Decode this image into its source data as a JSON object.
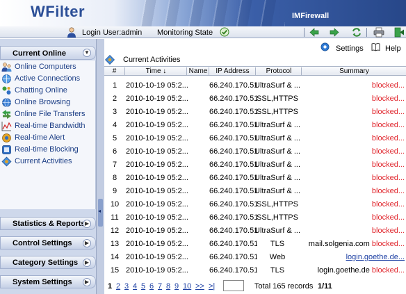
{
  "app": {
    "logo": "WFilter",
    "product": "IMFirewall"
  },
  "topbar": {
    "login_label": "Login User:admin",
    "monitor_label": "Monitoring State"
  },
  "sidebar": {
    "header": "Current Online",
    "items": [
      {
        "label": "Online Computers",
        "icon": "computers-icon"
      },
      {
        "label": "Active Connections",
        "icon": "connections-icon"
      },
      {
        "label": "Chatting Online",
        "icon": "chat-icon"
      },
      {
        "label": "Online Browsing",
        "icon": "globe-icon"
      },
      {
        "label": "Online File Transfers",
        "icon": "file-transfer-icon"
      },
      {
        "label": "Real-time Bandwidth",
        "icon": "bandwidth-icon"
      },
      {
        "label": "Real-time Alert",
        "icon": "alert-icon"
      },
      {
        "label": "Real-time Blocking",
        "icon": "blocking-icon"
      },
      {
        "label": "Current Activities",
        "icon": "activities-icon"
      }
    ],
    "sections": [
      "Statistics & Reports",
      "Control Settings",
      "Category Settings",
      "System Settings"
    ]
  },
  "main": {
    "settings_label": "Settings",
    "help_label": "Help",
    "title": "Current Activities",
    "columns": {
      "num": "#",
      "time": "Time ↓",
      "name": "Name",
      "ip": "IP Address",
      "protocol": "Protocol",
      "summary": "Summary"
    },
    "rows": [
      {
        "num": "1",
        "time": "2010-10-19 05:2...",
        "ip": "66.240.170.51",
        "protocol": "UltraSurf & ...",
        "summary_text": "",
        "summary_status": "blocked..."
      },
      {
        "num": "2",
        "time": "2010-10-19 05:2...",
        "ip": "66.240.170.51",
        "protocol": "SSL,HTTPS",
        "summary_text": "",
        "summary_status": "blocked..."
      },
      {
        "num": "3",
        "time": "2010-10-19 05:2...",
        "ip": "66.240.170.51",
        "protocol": "SSL,HTTPS",
        "summary_text": "",
        "summary_status": "blocked..."
      },
      {
        "num": "4",
        "time": "2010-10-19 05:2...",
        "ip": "66.240.170.51",
        "protocol": "UltraSurf & ...",
        "summary_text": "",
        "summary_status": "blocked..."
      },
      {
        "num": "5",
        "time": "2010-10-19 05:2...",
        "ip": "66.240.170.51",
        "protocol": "UltraSurf & ...",
        "summary_text": "",
        "summary_status": "blocked..."
      },
      {
        "num": "6",
        "time": "2010-10-19 05:2...",
        "ip": "66.240.170.51",
        "protocol": "UltraSurf & ...",
        "summary_text": "",
        "summary_status": "blocked..."
      },
      {
        "num": "7",
        "time": "2010-10-19 05:2...",
        "ip": "66.240.170.51",
        "protocol": "UltraSurf & ...",
        "summary_text": "",
        "summary_status": "blocked..."
      },
      {
        "num": "8",
        "time": "2010-10-19 05:2...",
        "ip": "66.240.170.51",
        "protocol": "UltraSurf & ...",
        "summary_text": "",
        "summary_status": "blocked..."
      },
      {
        "num": "9",
        "time": "2010-10-19 05:2...",
        "ip": "66.240.170.51",
        "protocol": "UltraSurf & ...",
        "summary_text": "",
        "summary_status": "blocked..."
      },
      {
        "num": "10",
        "time": "2010-10-19 05:2...",
        "ip": "66.240.170.51",
        "protocol": "SSL,HTTPS",
        "summary_text": "",
        "summary_status": "blocked..."
      },
      {
        "num": "11",
        "time": "2010-10-19 05:2...",
        "ip": "66.240.170.51",
        "protocol": "SSL,HTTPS",
        "summary_text": "",
        "summary_status": "blocked..."
      },
      {
        "num": "12",
        "time": "2010-10-19 05:2...",
        "ip": "66.240.170.51",
        "protocol": "UltraSurf & ...",
        "summary_text": "",
        "summary_status": "blocked..."
      },
      {
        "num": "13",
        "time": "2010-10-19 05:2...",
        "ip": "66.240.170.51",
        "protocol": "TLS",
        "summary_text": "mail.solgenia.com",
        "summary_status": "blocked..."
      },
      {
        "num": "14",
        "time": "2010-10-19 05:2...",
        "ip": "66.240.170.51",
        "protocol": "Web",
        "summary_text": "login.goethe.de...",
        "summary_status": ""
      },
      {
        "num": "15",
        "time": "2010-10-19 05:2...",
        "ip": "66.240.170.51",
        "protocol": "TLS",
        "summary_text": "login.goethe.de",
        "summary_status": "blocked..."
      }
    ],
    "pager": {
      "pages": [
        "1",
        "2",
        "3",
        "4",
        "5",
        "6",
        "7",
        "8",
        "9",
        "10",
        ">>",
        ">|"
      ],
      "total": "Total 165 records",
      "page_of": "1/11"
    }
  },
  "colors": {
    "blocked": "#e0242b",
    "link": "#1c3fa3",
    "nav_text": "#1d3f86",
    "sidebar_bg": "#ced8eb"
  }
}
